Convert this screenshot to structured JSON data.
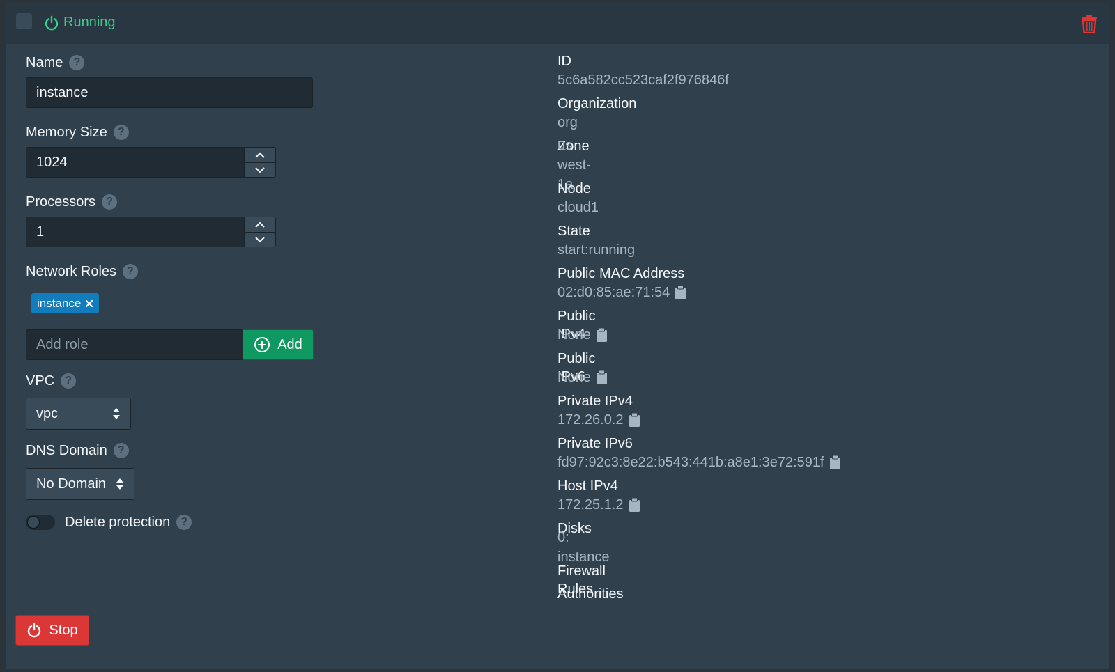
{
  "header": {
    "status": "Running"
  },
  "form": {
    "name": {
      "label": "Name",
      "value": "instance"
    },
    "memory": {
      "label": "Memory Size",
      "value": "1024"
    },
    "processors": {
      "label": "Processors",
      "value": "1"
    },
    "network_roles": {
      "label": "Network Roles",
      "tags": [
        "instance"
      ],
      "placeholder": "Add role",
      "add_label": "Add"
    },
    "vpc": {
      "label": "VPC",
      "value": "vpc"
    },
    "dns": {
      "label": "DNS Domain",
      "value": "No Domain"
    },
    "delete_protection": {
      "label": "Delete protection",
      "enabled": false
    }
  },
  "details": [
    {
      "key": "ID",
      "value": "5c6a582cc523caf2f976846f",
      "copy": false
    },
    {
      "key": "Organization",
      "value": "org",
      "copy": false
    },
    {
      "key": "Zone",
      "value": "us-west-1a",
      "copy": false
    },
    {
      "key": "Node",
      "value": "cloud1",
      "copy": false
    },
    {
      "key": "State",
      "value": "start:running",
      "copy": false
    },
    {
      "key": "Public MAC Address",
      "value": "02:d0:85:ae:71:54",
      "copy": true
    },
    {
      "key": "Public IPv4",
      "value": "None",
      "copy": true
    },
    {
      "key": "Public IPv6",
      "value": "None",
      "copy": true
    },
    {
      "key": "Private IPv4",
      "value": "172.26.0.2",
      "copy": true
    },
    {
      "key": "Private IPv6",
      "value": "fd97:92c3:8e22:b543:441b:a8e1:3e72:591f",
      "copy": true
    },
    {
      "key": "Host IPv4",
      "value": "172.25.1.2",
      "copy": true
    },
    {
      "key": "Disks",
      "value": "0: instance",
      "copy": false
    },
    {
      "key": "Firewall Rules",
      "value": "",
      "copy": false
    },
    {
      "key": "Authorities",
      "value": "",
      "copy": false
    }
  ],
  "footer": {
    "stop_label": "Stop"
  },
  "colors": {
    "running": "#3dcc91",
    "danger": "#db3737",
    "success": "#0f9960",
    "tag": "#137cbd"
  },
  "icons": {
    "status": "power-icon",
    "delete": "trash-icon",
    "help": "help-icon",
    "copy": "clipboard-icon",
    "add": "plus-circle-icon",
    "stop": "power-icon"
  }
}
